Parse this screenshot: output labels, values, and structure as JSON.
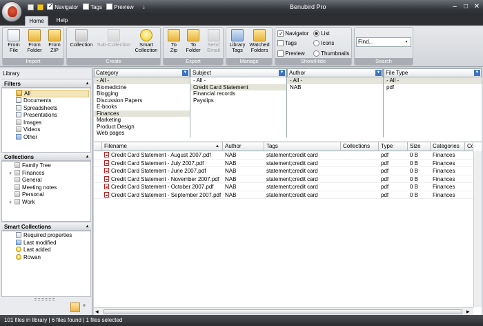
{
  "app": {
    "title": "Benubird Pro"
  },
  "qat": {
    "navigator": "Navigator",
    "tags": "Tags",
    "preview": "Preview"
  },
  "window_controls": {
    "minimize": "–",
    "restore": "□",
    "close": "✕"
  },
  "tabs": [
    {
      "label": "Home"
    },
    {
      "label": "Help"
    }
  ],
  "ribbon": {
    "import": {
      "title": "Import",
      "buttons": [
        {
          "label1": "From",
          "label2": "File"
        },
        {
          "label1": "From",
          "label2": "Folder"
        },
        {
          "label1": "From",
          "label2": "ZIP"
        }
      ]
    },
    "create": {
      "title": "Create",
      "collection": "Collection",
      "sub_collection": "Sub-Collection",
      "smart1": "Smart",
      "smart2": "Collection"
    },
    "export": {
      "title": "Export",
      "to_zip1": "To",
      "to_zip2": "Zip",
      "to_folder1": "To",
      "to_folder2": "Folder",
      "send1": "Send",
      "send2": "Email"
    },
    "manage": {
      "title": "Manage",
      "library1": "Library",
      "library2": "Tags",
      "watched1": "Watched",
      "watched2": "Folders"
    },
    "showhide": {
      "title": "Show/Hide",
      "navigator": "Navigator",
      "tags": "Tags",
      "preview": "Preview",
      "list": "List",
      "icons": "Icons",
      "thumbnails": "Thumbnails"
    },
    "search": {
      "title": "Search",
      "placeholder": "Find..."
    }
  },
  "left": {
    "library": "Library",
    "filters_title": "Filters",
    "filters": [
      "All",
      "Documents",
      "Spreadsheets",
      "Presentations",
      "Images",
      "Videos",
      "Other"
    ],
    "collections_title": "Collections",
    "collections": [
      {
        "label": "Family Tree",
        "expand": ""
      },
      {
        "label": "Finances",
        "expand": "+"
      },
      {
        "label": "General",
        "expand": ""
      },
      {
        "label": "Meeting notes",
        "expand": ""
      },
      {
        "label": "Personal",
        "expand": ""
      },
      {
        "label": "Work",
        "expand": "+"
      }
    ],
    "smart_title": "Smart Collections",
    "smart": [
      "Required properties",
      "Last modified",
      "Last added",
      "Rowan"
    ]
  },
  "filters": {
    "category": {
      "header": "Category",
      "options": [
        "- All -",
        "Biomedicine",
        "Blogging",
        "Discussion Papers",
        "E-books",
        "Finances",
        "Marketing",
        "Product Design",
        "Web pages"
      ]
    },
    "subject": {
      "header": "Subject",
      "options": [
        "- All -",
        "Credit Card Statement",
        "Financial records",
        "Payslips"
      ]
    },
    "author": {
      "header": "Author",
      "options": [
        "- All -",
        "NAB"
      ]
    },
    "filetype": {
      "header": "File Type",
      "options": [
        "- All -",
        "pdf"
      ]
    }
  },
  "grid": {
    "columns": [
      "Filename",
      "Author",
      "Tags",
      "Collections",
      "Type",
      "Size",
      "Categories",
      "Comm"
    ],
    "rows": [
      [
        "Credit Card Statement - August 2007.pdf",
        "NAB",
        "statement;credit card",
        "",
        "pdf",
        "0 B",
        "Finances",
        ""
      ],
      [
        "Credit Card Statement - July 2007.pdf",
        "NAB",
        "statement;credit card",
        "",
        "pdf",
        "0 B",
        "Finances",
        ""
      ],
      [
        "Credit Card Statement - June 2007.pdf",
        "NAB",
        "statement;credit card",
        "",
        "pdf",
        "0 B",
        "Finances",
        ""
      ],
      [
        "Credit Card Statement - November 2007.pdf",
        "NAB",
        "statement;credit card",
        "",
        "pdf",
        "0 B",
        "Finances",
        ""
      ],
      [
        "Credit Card Statement - October 2007.pdf",
        "NAB",
        "statement;credit card",
        "",
        "pdf",
        "0 B",
        "Finances",
        ""
      ],
      [
        "Credit Card Statement - September 2007.pdf",
        "NAB",
        "statement;credit card",
        "",
        "pdf",
        "0 B",
        "Finances",
        ""
      ]
    ]
  },
  "status": {
    "text": "101 files in library | 6 files found | 1 files selected"
  }
}
